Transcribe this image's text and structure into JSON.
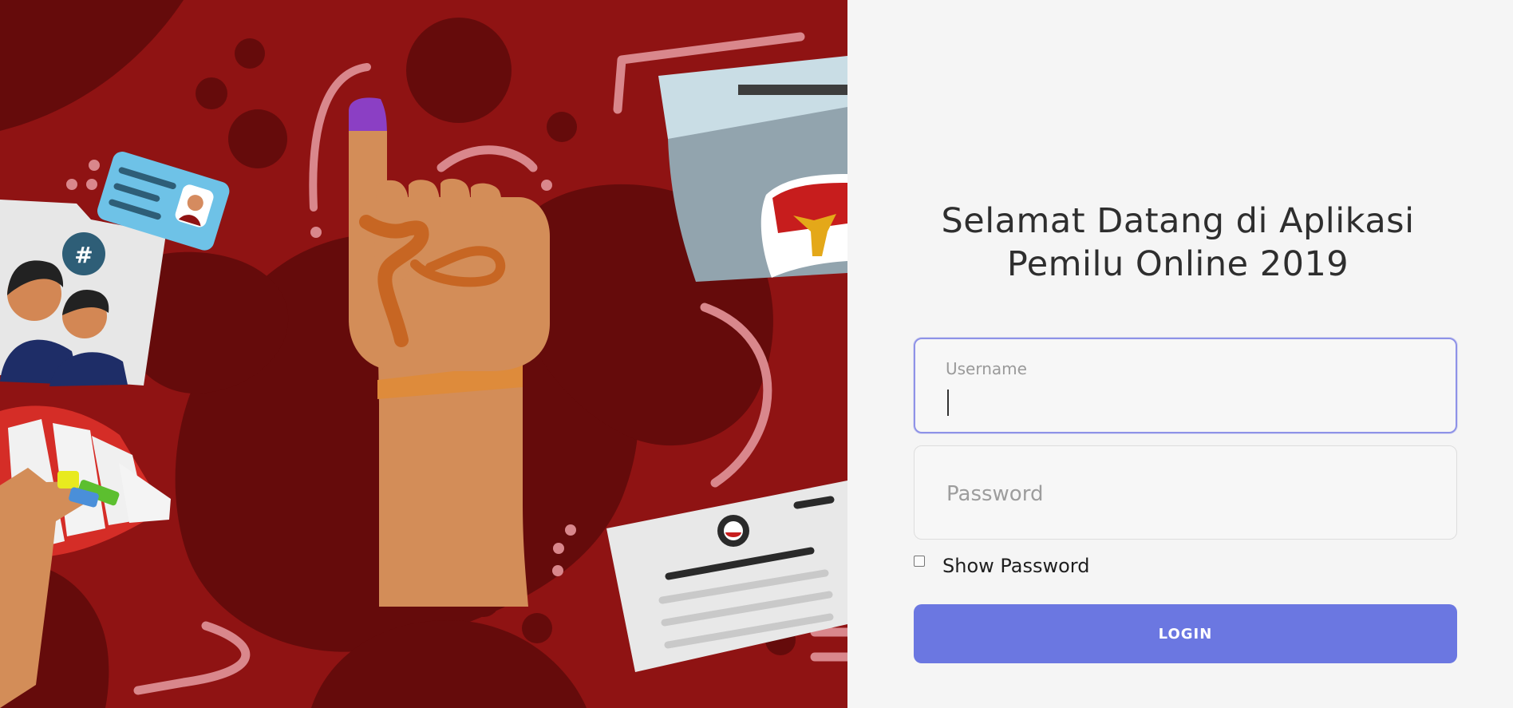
{
  "hero": {
    "illustration_name": "election-illustration",
    "background_color": "#8f1313",
    "accent_color": "#6b77e1"
  },
  "login": {
    "title": "Selamat Datang di Aplikasi Pemilu Online 2019",
    "username_label": "Username",
    "username_value": "",
    "password_placeholder": "Password",
    "password_value": "",
    "show_password_label": "Show Password",
    "show_password_checked": false,
    "login_button_label": "LOGIN"
  }
}
